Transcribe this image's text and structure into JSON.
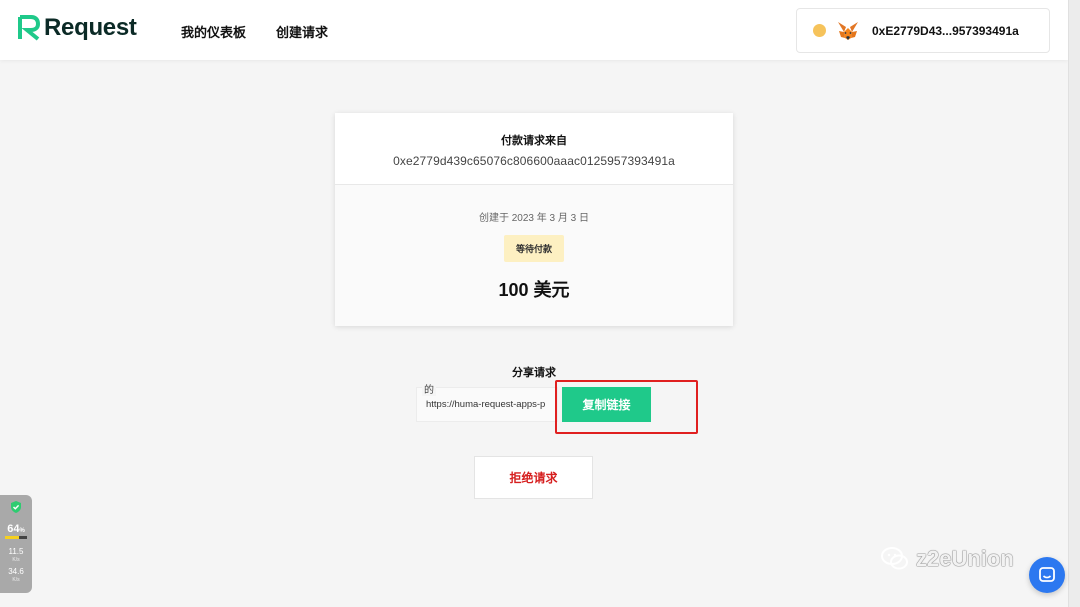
{
  "header": {
    "logo_text": "Request",
    "nav": [
      "我的仪表板",
      "创建请求"
    ],
    "wallet_address": "0xE2779D43...957393491a",
    "wallet_dot_color": "#f6c35b",
    "brand_color": "#1fc98a"
  },
  "request": {
    "from_label": "付款请求来自",
    "from_address": "0xe2779d439c65076c806600aaac0125957393491a",
    "created": "创建于 2023 年 3 月 3 日",
    "status_badge": "等待付款",
    "amount": "100 美元"
  },
  "share": {
    "title": "分享请求",
    "field_label": "的",
    "link_value": "https://huma-request-apps-p",
    "copy_label": "复制链接"
  },
  "reject_label": "拒绝请求",
  "side_widget": {
    "percent": "64",
    "percent_unit": "%",
    "percent_fill": 0.64,
    "up_speed": "11.5",
    "up_unit": "K/s",
    "down_speed": "34.6",
    "down_unit": "K/s"
  },
  "watermark": "z2eUnion"
}
